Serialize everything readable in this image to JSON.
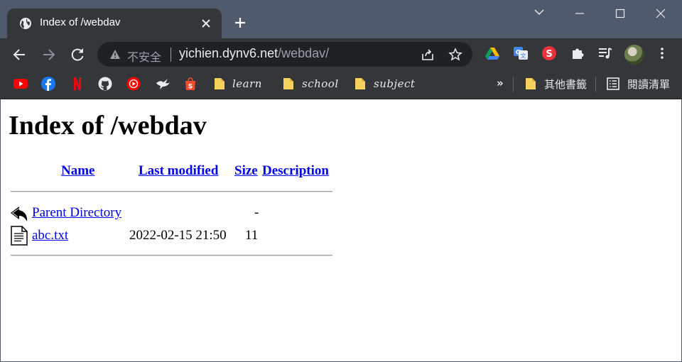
{
  "browser": {
    "tab": {
      "title": "Index of /webdav",
      "icon": "globe-icon"
    },
    "omnibox": {
      "security_label": "不安全",
      "url_host": "yichien.dynv6.net",
      "url_path": "/webdav/"
    },
    "bookmarks": {
      "folders": [
        {
          "label": "learn"
        },
        {
          "label": "school"
        },
        {
          "label": "subject"
        }
      ],
      "overflow": "»",
      "other_bookmarks": "其他書籤",
      "reading_list": "閱讀清單"
    },
    "colors": {
      "frame": "#4f5b6c",
      "toolbar": "#35363a",
      "omnibox": "#202124",
      "link": "#0000ee"
    }
  },
  "page": {
    "title": "Index of /webdav",
    "columns": {
      "name": "Name",
      "last_modified": "Last modified",
      "size": "Size",
      "description": "Description"
    },
    "rows": [
      {
        "icon": "back-arrow-icon",
        "name": "Parent Directory",
        "last_modified": "",
        "size": "-",
        "description": ""
      },
      {
        "icon": "text-file-icon",
        "name": "abc.txt",
        "last_modified": "2022-02-15 21:50",
        "size": "11",
        "description": ""
      }
    ]
  }
}
